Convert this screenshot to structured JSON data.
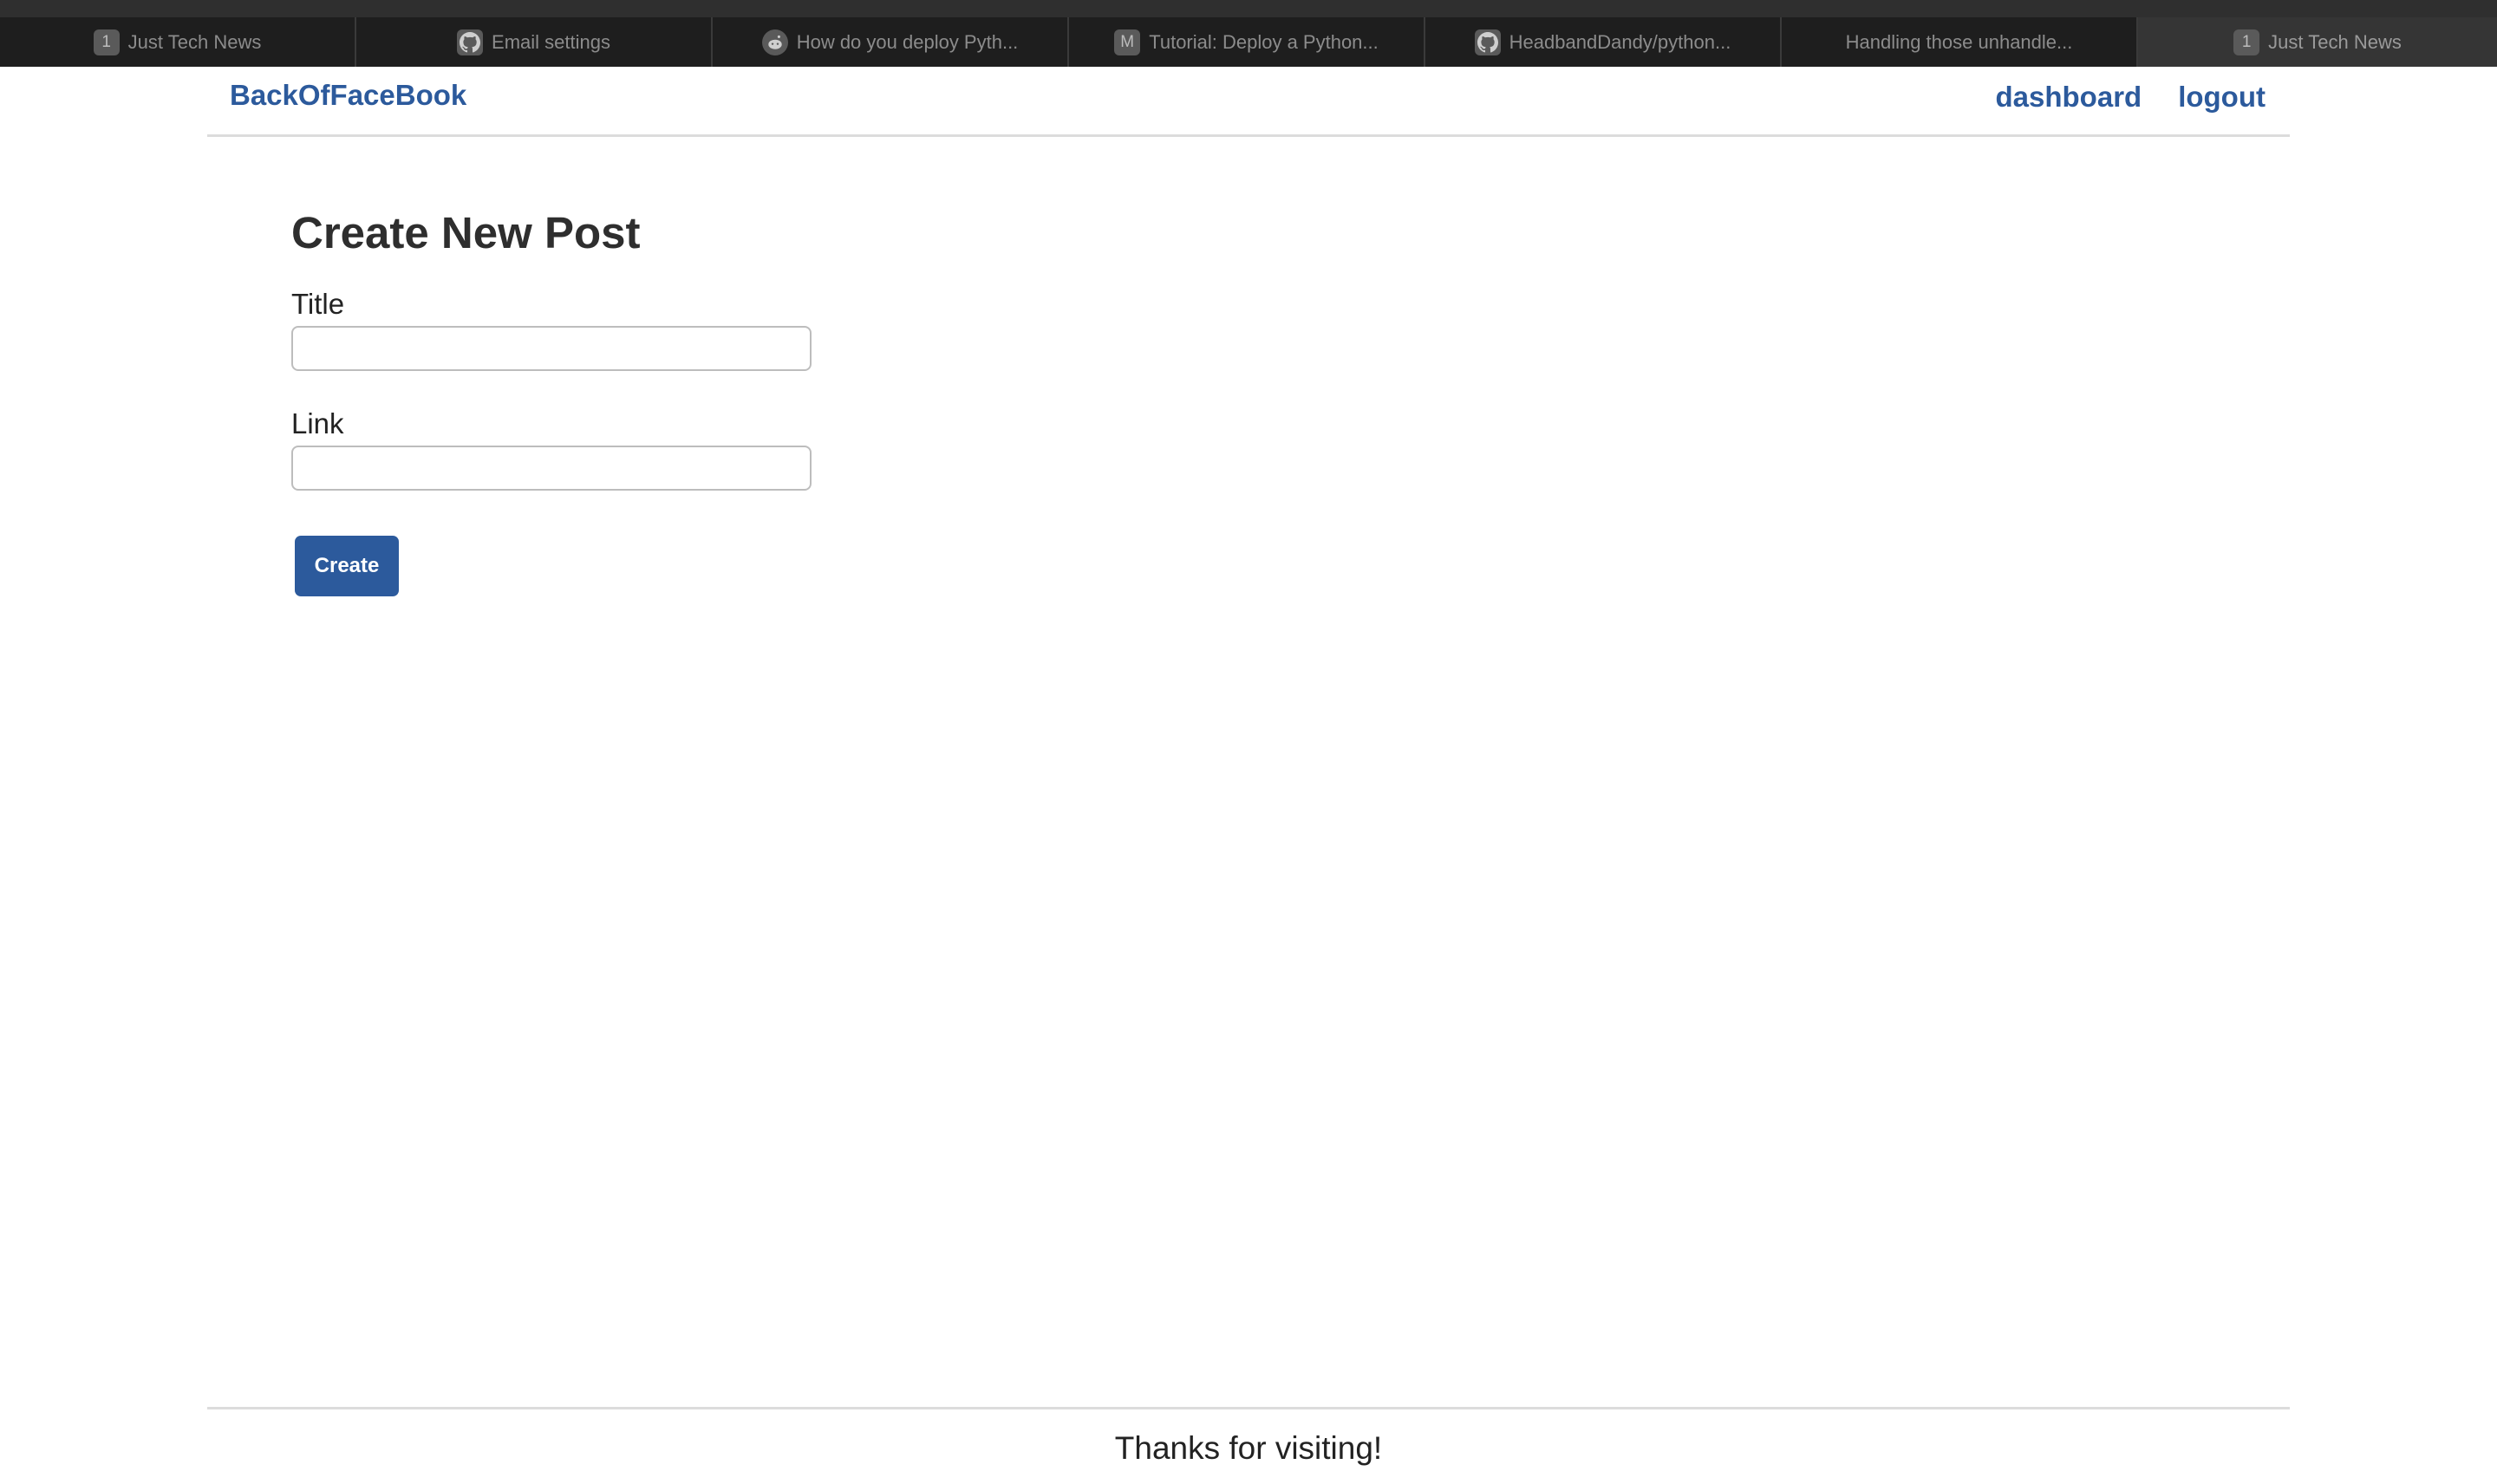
{
  "browser": {
    "tabs": [
      {
        "title": "Just Tech News",
        "favicon_text": "1",
        "favicon": "number-badge-icon"
      },
      {
        "title": "Email settings",
        "favicon_text": "",
        "favicon": "github-icon"
      },
      {
        "title": "How do you deploy Pyth...",
        "favicon_text": "",
        "favicon": "reddit-icon"
      },
      {
        "title": "Tutorial: Deploy a Python...",
        "favicon_text": "M",
        "favicon": "medium-icon"
      },
      {
        "title": "HeadbandDandy/python...",
        "favicon_text": "",
        "favicon": "github-icon"
      },
      {
        "title": "Handling those unhandle...",
        "favicon_text": "",
        "favicon": "none"
      },
      {
        "title": "Just Tech News",
        "favicon_text": "1",
        "favicon": "number-badge-icon",
        "active": true
      }
    ]
  },
  "nav": {
    "brand": "BackOfFaceBook",
    "links": {
      "dashboard": "dashboard",
      "logout": "logout"
    }
  },
  "form": {
    "heading": "Create New Post",
    "title_label": "Title",
    "title_value": "",
    "link_label": "Link",
    "link_value": "",
    "submit_label": "Create"
  },
  "footer": {
    "text": "Thanks for visiting!"
  },
  "colors": {
    "accent": "#2c5a9c",
    "tabstrip": "#2b2b2b"
  }
}
